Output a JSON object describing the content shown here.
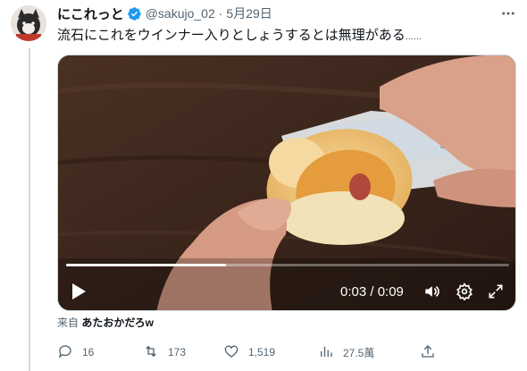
{
  "tweet": {
    "display_name": "にこれっと",
    "handle": "@sakujo_02",
    "separator": "·",
    "date": "5月29日",
    "text": "流石にこれをウインナー入りとしょうするとは無理がある",
    "trailing_dots": "……"
  },
  "video": {
    "time_display": "0:03 / 0:09",
    "progress": 0.36
  },
  "via": {
    "label": "来自",
    "source": "あたおかだろw"
  },
  "actions": {
    "replies": "16",
    "retweets": "173",
    "likes": "1,519",
    "views": "27.5萬"
  },
  "colors": {
    "verified": "#1d9bf0",
    "secondary_text": "#536471"
  },
  "icons": [
    "verified-badge-icon",
    "more-icon",
    "play-icon",
    "volume-icon",
    "settings-icon",
    "fullscreen-icon",
    "reply-icon",
    "retweet-icon",
    "like-icon",
    "views-icon",
    "share-icon"
  ]
}
